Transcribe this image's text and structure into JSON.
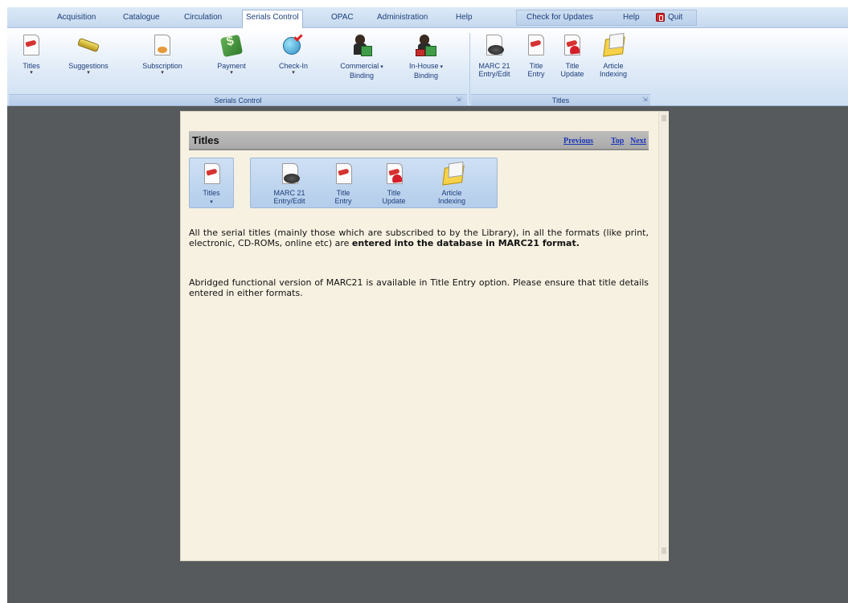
{
  "menu": {
    "items": [
      "Acquisition",
      "Catalogue",
      "Circulation",
      "Serials Control",
      "OPAC",
      "Administration",
      "Help"
    ],
    "active": "Serials Control",
    "check_updates": "Check for Updates",
    "help": "Help",
    "quit": "Quit"
  },
  "ribbon": {
    "serials_group": {
      "label": "Serials Control",
      "buttons": [
        {
          "label": "Titles",
          "icon": "titles-icon",
          "dropdown": true
        },
        {
          "label": "Suggestions",
          "icon": "suggestions-icon",
          "dropdown": true
        },
        {
          "label": "Subscription",
          "icon": "subscription-icon",
          "dropdown": true
        },
        {
          "label": "Payment",
          "icon": "payment-icon",
          "dropdown": true
        },
        {
          "label": "Check-In",
          "icon": "check-in-icon",
          "dropdown": true
        },
        {
          "label_line1": "Commercial",
          "label_line2": "Binding",
          "icon": "commercial-binding-icon",
          "dropdown": true
        },
        {
          "label_line1": "In-House",
          "label_line2": "Binding",
          "icon": "in-house-binding-icon",
          "dropdown": true
        }
      ]
    },
    "titles_group": {
      "label": "Titles",
      "buttons": [
        {
          "label_line1": "MARC 21",
          "label_line2": "Entry/Edit",
          "icon": "marc21-icon"
        },
        {
          "label_line1": "Title",
          "label_line2": "Entry",
          "icon": "title-entry-icon"
        },
        {
          "label_line1": "Title",
          "label_line2": "Update",
          "icon": "title-update-icon"
        },
        {
          "label_line1": "Article",
          "label_line2": "Indexing",
          "icon": "article-indexing-icon"
        }
      ]
    }
  },
  "panel": {
    "title": "Titles",
    "nav": {
      "previous": "Previous",
      "top": "Top",
      "next": "Next"
    },
    "mini": {
      "titles": "Titles",
      "marc_line1": "MARC 21",
      "marc_line2": "Entry/Edit",
      "entry_line1": "Title",
      "entry_line2": "Entry",
      "update_line1": "Title",
      "update_line2": "Update",
      "index_line1": "Article",
      "index_line2": "Indexing"
    },
    "para1_normal": "All the serial titles (mainly those which are subscribed to by the Library), in all the formats (like print, electronic, CD-ROMs, online etc) are ",
    "para1_bold": "entered into the database in MARC21 format.",
    "para2": "Abridged functional version of MARC21 is available in Title Entry option.  Please ensure that title details entered in either formats."
  },
  "colors": {
    "frame": "#565a5c",
    "ribbon_text": "#1c3e79",
    "panel_bg": "#f7f1e1",
    "link": "#1b36b8",
    "quit_red": "#d0262a"
  }
}
